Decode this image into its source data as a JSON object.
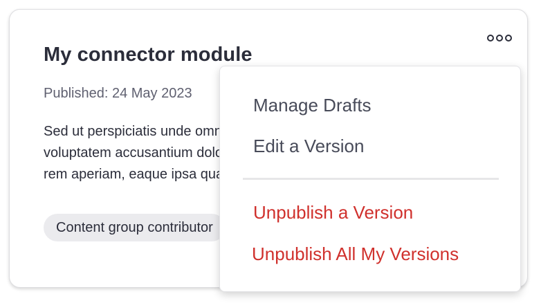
{
  "card": {
    "title": "My connector module",
    "published": "Published: 24 May 2023",
    "description_lines": [
      "Sed ut perspiciatis unde omnis iste natus error sit",
      "voluptatem accusantium doloremque laudantium, totam",
      "rem aperiam, eaque ipsa quae ab illo inventore"
    ],
    "tag": "Content group contributor"
  },
  "menu": {
    "items": [
      {
        "label": "Manage Drafts",
        "tone": "neutral"
      },
      {
        "label": "Edit a Version",
        "tone": "neutral"
      },
      {
        "label": "Unpublish a Version",
        "tone": "danger"
      },
      {
        "label": "Unpublish All My Versions",
        "tone": "danger"
      }
    ]
  },
  "colors": {
    "text": "#2b2d3a",
    "muted": "#5f6070",
    "danger": "#d0312d",
    "tag_bg": "#ebebee"
  },
  "icons": {
    "more": "more-horizontal-icon"
  }
}
